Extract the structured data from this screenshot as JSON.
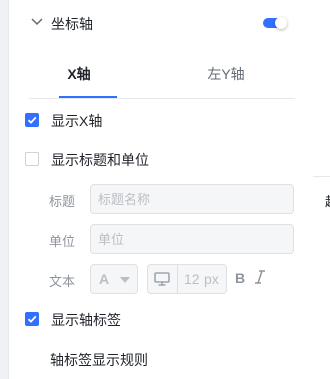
{
  "section": {
    "title": "坐标轴",
    "enabled": true
  },
  "tabs": [
    {
      "label": "X轴",
      "active": true
    },
    {
      "label": "左Y轴",
      "active": false
    }
  ],
  "show_axis": {
    "label": "显示X轴",
    "checked": true
  },
  "show_title_unit": {
    "label": "显示标题和单位",
    "checked": false
  },
  "title_field": {
    "label": "标题",
    "placeholder": "标题名称"
  },
  "unit_field": {
    "label": "单位",
    "placeholder": "单位"
  },
  "text_style": {
    "label": "文本",
    "color_glyph": "A",
    "font_size": "12",
    "font_unit": "px",
    "bold_glyph": "B"
  },
  "show_tick_labels": {
    "label": "显示轴标签",
    "checked": true
  },
  "tick_label_rule": {
    "label": "轴标签显示规则"
  },
  "right_panel": {
    "peek_text": "起"
  },
  "colors": {
    "accent": "#3370ff",
    "text": "#1f2329",
    "muted": "#8f959e",
    "disabled": "#bbbfc4"
  }
}
